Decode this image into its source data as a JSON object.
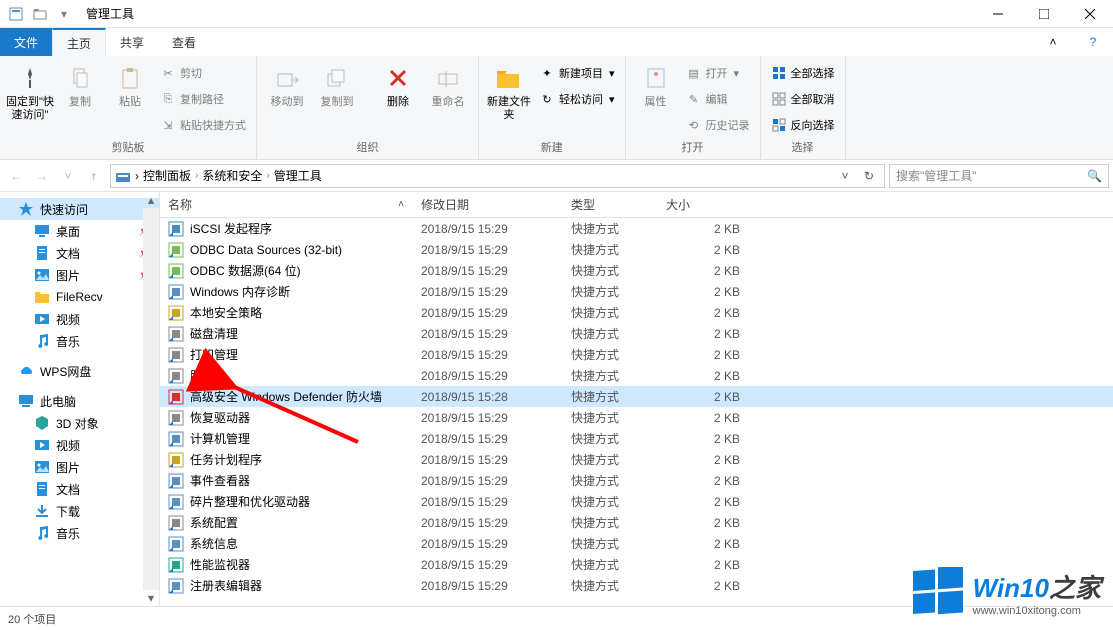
{
  "window_title": "管理工具",
  "ribbon_tabs": {
    "file": "文件",
    "home": "主页",
    "share": "共享",
    "view": "查看"
  },
  "groups": {
    "clipboard": {
      "label": "剪贴板",
      "pin": "固定到\"快速访问\"",
      "copy": "复制",
      "paste": "粘贴",
      "cut": "剪切",
      "copy_path": "复制路径",
      "paste_shortcut": "粘贴快捷方式"
    },
    "organize": {
      "label": "组织",
      "move_to": "移动到",
      "copy_to": "复制到",
      "delete": "删除",
      "rename": "重命名"
    },
    "new": {
      "label": "新建",
      "new_folder": "新建文件夹",
      "new_item": "新建项目",
      "easy_access": "轻松访问"
    },
    "open": {
      "label": "打开",
      "properties": "属性",
      "open": "打开",
      "edit": "编辑",
      "history": "历史记录"
    },
    "select": {
      "label": "选择",
      "select_all": "全部选择",
      "select_none": "全部取消",
      "invert": "反向选择"
    }
  },
  "breadcrumbs": [
    "控制面板",
    "系统和安全",
    "管理工具"
  ],
  "search_placeholder": "搜索\"管理工具\"",
  "columns": {
    "name": "名称",
    "date": "修改日期",
    "type": "类型",
    "size": "大小"
  },
  "rows": [
    {
      "name": "iSCSI 发起程序",
      "date": "2018/9/15 15:29",
      "type": "快捷方式",
      "size": "2 KB"
    },
    {
      "name": "ODBC Data Sources (32-bit)",
      "date": "2018/9/15 15:29",
      "type": "快捷方式",
      "size": "2 KB"
    },
    {
      "name": "ODBC 数据源(64 位)",
      "date": "2018/9/15 15:29",
      "type": "快捷方式",
      "size": "2 KB"
    },
    {
      "name": "Windows 内存诊断",
      "date": "2018/9/15 15:29",
      "type": "快捷方式",
      "size": "2 KB"
    },
    {
      "name": "本地安全策略",
      "date": "2018/9/15 15:29",
      "type": "快捷方式",
      "size": "2 KB"
    },
    {
      "name": "磁盘清理",
      "date": "2018/9/15 15:29",
      "type": "快捷方式",
      "size": "2 KB"
    },
    {
      "name": "打印管理",
      "date": "2018/9/15 15:29",
      "type": "快捷方式",
      "size": "2 KB"
    },
    {
      "name": "服务",
      "date": "2018/9/15 15:29",
      "type": "快捷方式",
      "size": "2 KB"
    },
    {
      "name": "高级安全 Windows Defender 防火墙",
      "date": "2018/9/15 15:28",
      "type": "快捷方式",
      "size": "2 KB",
      "selected": true
    },
    {
      "name": "恢复驱动器",
      "date": "2018/9/15 15:29",
      "type": "快捷方式",
      "size": "2 KB"
    },
    {
      "name": "计算机管理",
      "date": "2018/9/15 15:29",
      "type": "快捷方式",
      "size": "2 KB"
    },
    {
      "name": "任务计划程序",
      "date": "2018/9/15 15:29",
      "type": "快捷方式",
      "size": "2 KB"
    },
    {
      "name": "事件查看器",
      "date": "2018/9/15 15:29",
      "type": "快捷方式",
      "size": "2 KB"
    },
    {
      "name": "碎片整理和优化驱动器",
      "date": "2018/9/15 15:29",
      "type": "快捷方式",
      "size": "2 KB"
    },
    {
      "name": "系统配置",
      "date": "2018/9/15 15:29",
      "type": "快捷方式",
      "size": "2 KB"
    },
    {
      "name": "系统信息",
      "date": "2018/9/15 15:29",
      "type": "快捷方式",
      "size": "2 KB"
    },
    {
      "name": "性能监视器",
      "date": "2018/9/15 15:29",
      "type": "快捷方式",
      "size": "2 KB"
    },
    {
      "name": "注册表编辑器",
      "date": "2018/9/15 15:29",
      "type": "快捷方式",
      "size": "2 KB"
    }
  ],
  "tree_items": [
    {
      "label": "快速访问",
      "icon": "star",
      "color": "#2b90d9",
      "selected": true
    },
    {
      "label": "桌面",
      "icon": "desktop",
      "color": "#2b90d9",
      "indent": true,
      "pin": true
    },
    {
      "label": "文档",
      "icon": "document",
      "color": "#2b90d9",
      "indent": true,
      "pin": true
    },
    {
      "label": "图片",
      "icon": "image",
      "color": "#2b90d9",
      "indent": true,
      "pin": true
    },
    {
      "label": "FileRecv",
      "icon": "folder",
      "color": "#fbc02d",
      "indent": true
    },
    {
      "label": "视频",
      "icon": "video",
      "color": "#2b90d9",
      "indent": true
    },
    {
      "label": "音乐",
      "icon": "music",
      "color": "#2b90d9",
      "indent": true
    },
    {
      "spacer": true
    },
    {
      "label": "WPS网盘",
      "icon": "cloud",
      "color": "#2196f3"
    },
    {
      "spacer": true
    },
    {
      "label": "此电脑",
      "icon": "pc",
      "color": "#2b90d9"
    },
    {
      "label": "3D 对象",
      "icon": "3d",
      "color": "#26a69a",
      "indent": true
    },
    {
      "label": "视频",
      "icon": "video",
      "color": "#2b90d9",
      "indent": true
    },
    {
      "label": "图片",
      "icon": "image",
      "color": "#2b90d9",
      "indent": true
    },
    {
      "label": "文档",
      "icon": "document",
      "color": "#2b90d9",
      "indent": true
    },
    {
      "label": "下载",
      "icon": "download",
      "color": "#2b90d9",
      "indent": true
    },
    {
      "label": "音乐",
      "icon": "music",
      "color": "#2b90d9",
      "indent": true
    }
  ],
  "status_text": "20 个项目",
  "watermark": {
    "line1_a": "Win10",
    "line1_b": "之家",
    "line2": "www.win10xitong.com"
  }
}
